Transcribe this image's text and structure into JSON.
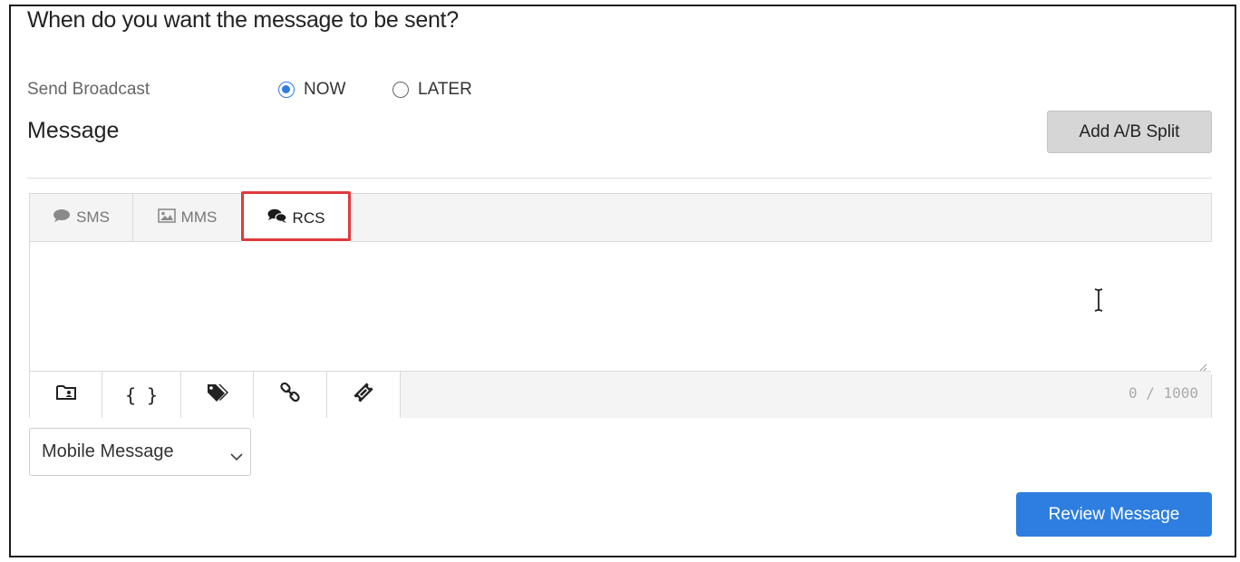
{
  "schedule": {
    "heading": "When do you want the message to be sent?",
    "send_label": "Send Broadcast",
    "options": [
      {
        "label": "NOW",
        "checked": true
      },
      {
        "label": "LATER",
        "checked": false
      }
    ]
  },
  "message": {
    "title": "Message",
    "ab_split_label": "Add A/B Split"
  },
  "tabs": [
    {
      "label": "SMS",
      "icon": "speech-bubble-icon",
      "active": false
    },
    {
      "label": "MMS",
      "icon": "image-icon",
      "active": false
    },
    {
      "label": "RCS",
      "icon": "chat-bubbles-icon",
      "active": true
    }
  ],
  "editor": {
    "value": "",
    "counter": "0 / 1000",
    "toolbar_icons": [
      "contact-card-icon",
      "braces-icon",
      "tags-icon",
      "link-icon",
      "ticket-icon"
    ],
    "toolbar_braces": "{ }"
  },
  "message_type": {
    "selected": "Mobile Message"
  },
  "footer": {
    "review_label": "Review Message"
  },
  "colors": {
    "accent": "#2d7ee0",
    "highlight": "#e03a3a"
  }
}
